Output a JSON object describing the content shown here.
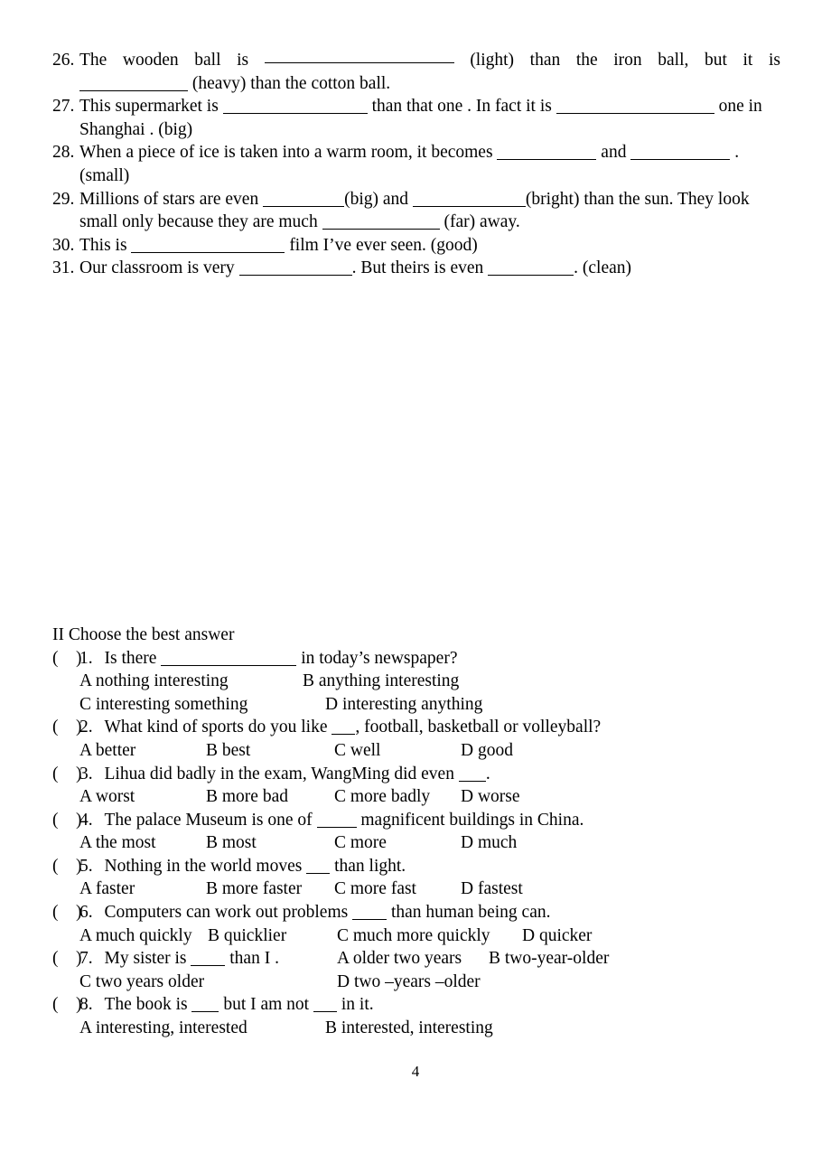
{
  "document": {
    "page_number": "4"
  },
  "fill_in_section": {
    "items": [
      {
        "number": "26.",
        "line1_words": [
          "The",
          "wooden",
          "ball",
          "is"
        ],
        "blank1_width": 210,
        "line1_tail_words": [
          "(light)",
          "than",
          "the",
          "iron",
          "ball,",
          "but",
          "it",
          "is"
        ],
        "line2_blank_width": 120,
        "line2_text": "(heavy) than the cotton ball."
      },
      {
        "number": "27.",
        "seg1": "This supermarket is",
        "blank1_width": 160,
        "seg2": "than that one . In fact it is",
        "blank2_width": 175,
        "seg3": "one",
        "line2_text": "in Shanghai . (big)"
      },
      {
        "number": "28.",
        "seg1": "When a piece of ice is taken into a warm room, it becomes",
        "blank1_width": 110,
        "seg2": "and",
        "blank2_width": 110,
        "seg3": ".",
        "line2_text": "(small)"
      },
      {
        "number": "29.",
        "seg1": "Millions of stars are even",
        "blank1_width": 90,
        "seg2": "(big) and",
        "blank2_width": 125,
        "seg3": "(bright) than the sun. They",
        "line2_seg1": "look small only because they are much",
        "line2_blank_width": 130,
        "line2_seg2": "(far) away."
      },
      {
        "number": "30.",
        "seg1": "This is",
        "blank1_width": 170,
        "seg2": "film I’ve ever seen. (good)"
      },
      {
        "number": "31.",
        "seg1": "Our classroom is very",
        "blank1_width": 125,
        "seg2": ". But theirs is even",
        "blank2_width": 95,
        "seg3": ". (clean)"
      }
    ]
  },
  "choice_section": {
    "heading": "II Choose the best answer",
    "paren_open": "(",
    "paren_close": ")",
    "questions": [
      {
        "number": "1.",
        "stem_before": "Is there",
        "blank_width": 150,
        "stem_after": "in today’s newspaper?",
        "rows": [
          [
            {
              "label": "A nothing interesting",
              "pos": "oA"
            },
            {
              "label": "B anything interesting",
              "pos": "oB2"
            }
          ],
          [
            {
              "label": "C interesting something",
              "pos": "oA"
            },
            {
              "label": "D interesting anything",
              "pos": "oD2"
            }
          ]
        ]
      },
      {
        "number": "2.",
        "stem_before": "What kind of sports do you like",
        "blank_width": 26,
        "stem_after": ", football, basketball or volleyball?",
        "rows": [
          [
            {
              "label": "A better",
              "pos": "oA"
            },
            {
              "label": "B best",
              "pos": "oB"
            },
            {
              "label": "C well",
              "pos": "oC"
            },
            {
              "label": "D good",
              "pos": "oD"
            }
          ]
        ]
      },
      {
        "number": "3.",
        "stem_before": "Lihua did badly in the exam, WangMing did even",
        "blank_width": 30,
        "stem_after": ".",
        "rows": [
          [
            {
              "label": "A worst",
              "pos": "oA"
            },
            {
              "label": "B more bad",
              "pos": "oB"
            },
            {
              "label": "C more badly",
              "pos": "oC"
            },
            {
              "label": "D worse",
              "pos": "oD"
            }
          ]
        ]
      },
      {
        "number": "4.",
        "stem_before": "The palace Museum is one of",
        "blank_width": 44,
        "stem_after": "magnificent buildings in China.",
        "rows": [
          [
            {
              "label": "A the most",
              "pos": "oA"
            },
            {
              "label": "B most",
              "pos": "oB"
            },
            {
              "label": "C more",
              "pos": "oC"
            },
            {
              "label": "D much",
              "pos": "oD"
            }
          ]
        ]
      },
      {
        "number": "5.",
        "stem_before": "Nothing in the world moves",
        "blank_width": 26,
        "stem_after": "than light.",
        "rows": [
          [
            {
              "label": "A faster",
              "pos": "oA"
            },
            {
              "label": "B more faster",
              "pos": "oB"
            },
            {
              "label": "C more fast",
              "pos": "oC"
            },
            {
              "label": "D fastest",
              "pos": "oD"
            }
          ]
        ]
      },
      {
        "number": "6.",
        "stem_before": "Computers can work out problems",
        "blank_width": 38,
        "stem_after": "than human being can.",
        "rows": [
          [
            {
              "label": "A much quickly",
              "pos": "oA"
            },
            {
              "label": "B quicklier",
              "pos": "oB6"
            },
            {
              "label": "C much more quickly",
              "pos": "oC6"
            },
            {
              "label": "D quicker",
              "pos": "oD6"
            }
          ]
        ]
      },
      {
        "number": "7.",
        "stem_before": "My sister is",
        "blank_width": 38,
        "stem_after": "than I .",
        "inline_options": [
          {
            "label": "A older two years",
            "pos": "oA7"
          },
          {
            "label": "B two-year-older",
            "pos": "oB7"
          }
        ],
        "rows": [
          [
            {
              "label": "C two years older",
              "pos": "oC7"
            },
            {
              "label": "D two –years –older",
              "pos": "oD7"
            }
          ]
        ]
      },
      {
        "number": "8.",
        "stem_before": "The book is",
        "blank_width": 30,
        "stem_mid": "but I am not",
        "blank2_width": 26,
        "stem_after": "in it.",
        "rows": [
          [
            {
              "label": "A interesting, interested",
              "pos": "oA"
            },
            {
              "label": "B interested, interesting",
              "pos": "oB8"
            }
          ]
        ]
      }
    ]
  }
}
